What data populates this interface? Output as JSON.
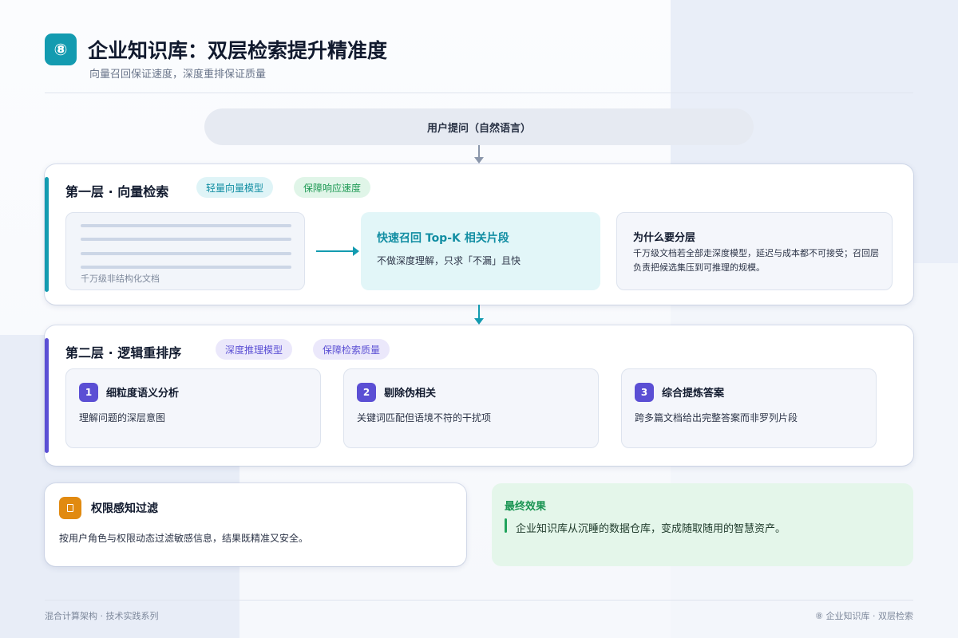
{
  "header": {
    "badge": "⑧",
    "title": "企业知识库：双层检索提升精准度",
    "subtitle": "向量召回保证速度，深度重排保证质量"
  },
  "query": {
    "label": "用户提问（自然语言）"
  },
  "layer1": {
    "title": "第一层 · 向量检索",
    "tags": [
      "轻量向量模型",
      "保障响应速度"
    ],
    "doc_caption": "千万级非结构化文档",
    "recall": {
      "title": "快速召回 Top-K 相关片段",
      "desc": "不做深度理解，只求「不漏」且快"
    },
    "why": {
      "title": "为什么要分层",
      "desc": "千万级文档若全部走深度模型，延迟与成本都不可接受；召回层负责把候选集压到可推理的规模。"
    }
  },
  "layer2": {
    "title": "第二层 · 逻辑重排序",
    "tags": [
      "深度推理模型",
      "保障检索质量"
    ],
    "steps": [
      {
        "num": "1",
        "title": "细粒度语义分析",
        "desc": "理解问题的深层意图"
      },
      {
        "num": "2",
        "title": "剔除伪相关",
        "desc": "关键词匹配但语境不符的干扰项"
      },
      {
        "num": "3",
        "title": "综合提炼答案",
        "desc": "跨多篇文档给出完整答案而非罗列片段"
      }
    ]
  },
  "permission": {
    "icon": "lock-icon",
    "title": "权限感知过滤",
    "desc": "按用户角色与权限动态过滤敏感信息，结果既精准又安全。"
  },
  "result": {
    "title": "最终效果",
    "text": "企业知识库从沉睡的数据仓库，变成随取随用的智慧资产。"
  },
  "footer": {
    "left": "混合计算架构 · 技术实践系列",
    "right": "⑧ 企业知识库 · 双层检索"
  },
  "colors": {
    "teal": "#139bb0",
    "purple": "#5b4fd4",
    "orange": "#e18a10",
    "green": "#1fa35b"
  }
}
